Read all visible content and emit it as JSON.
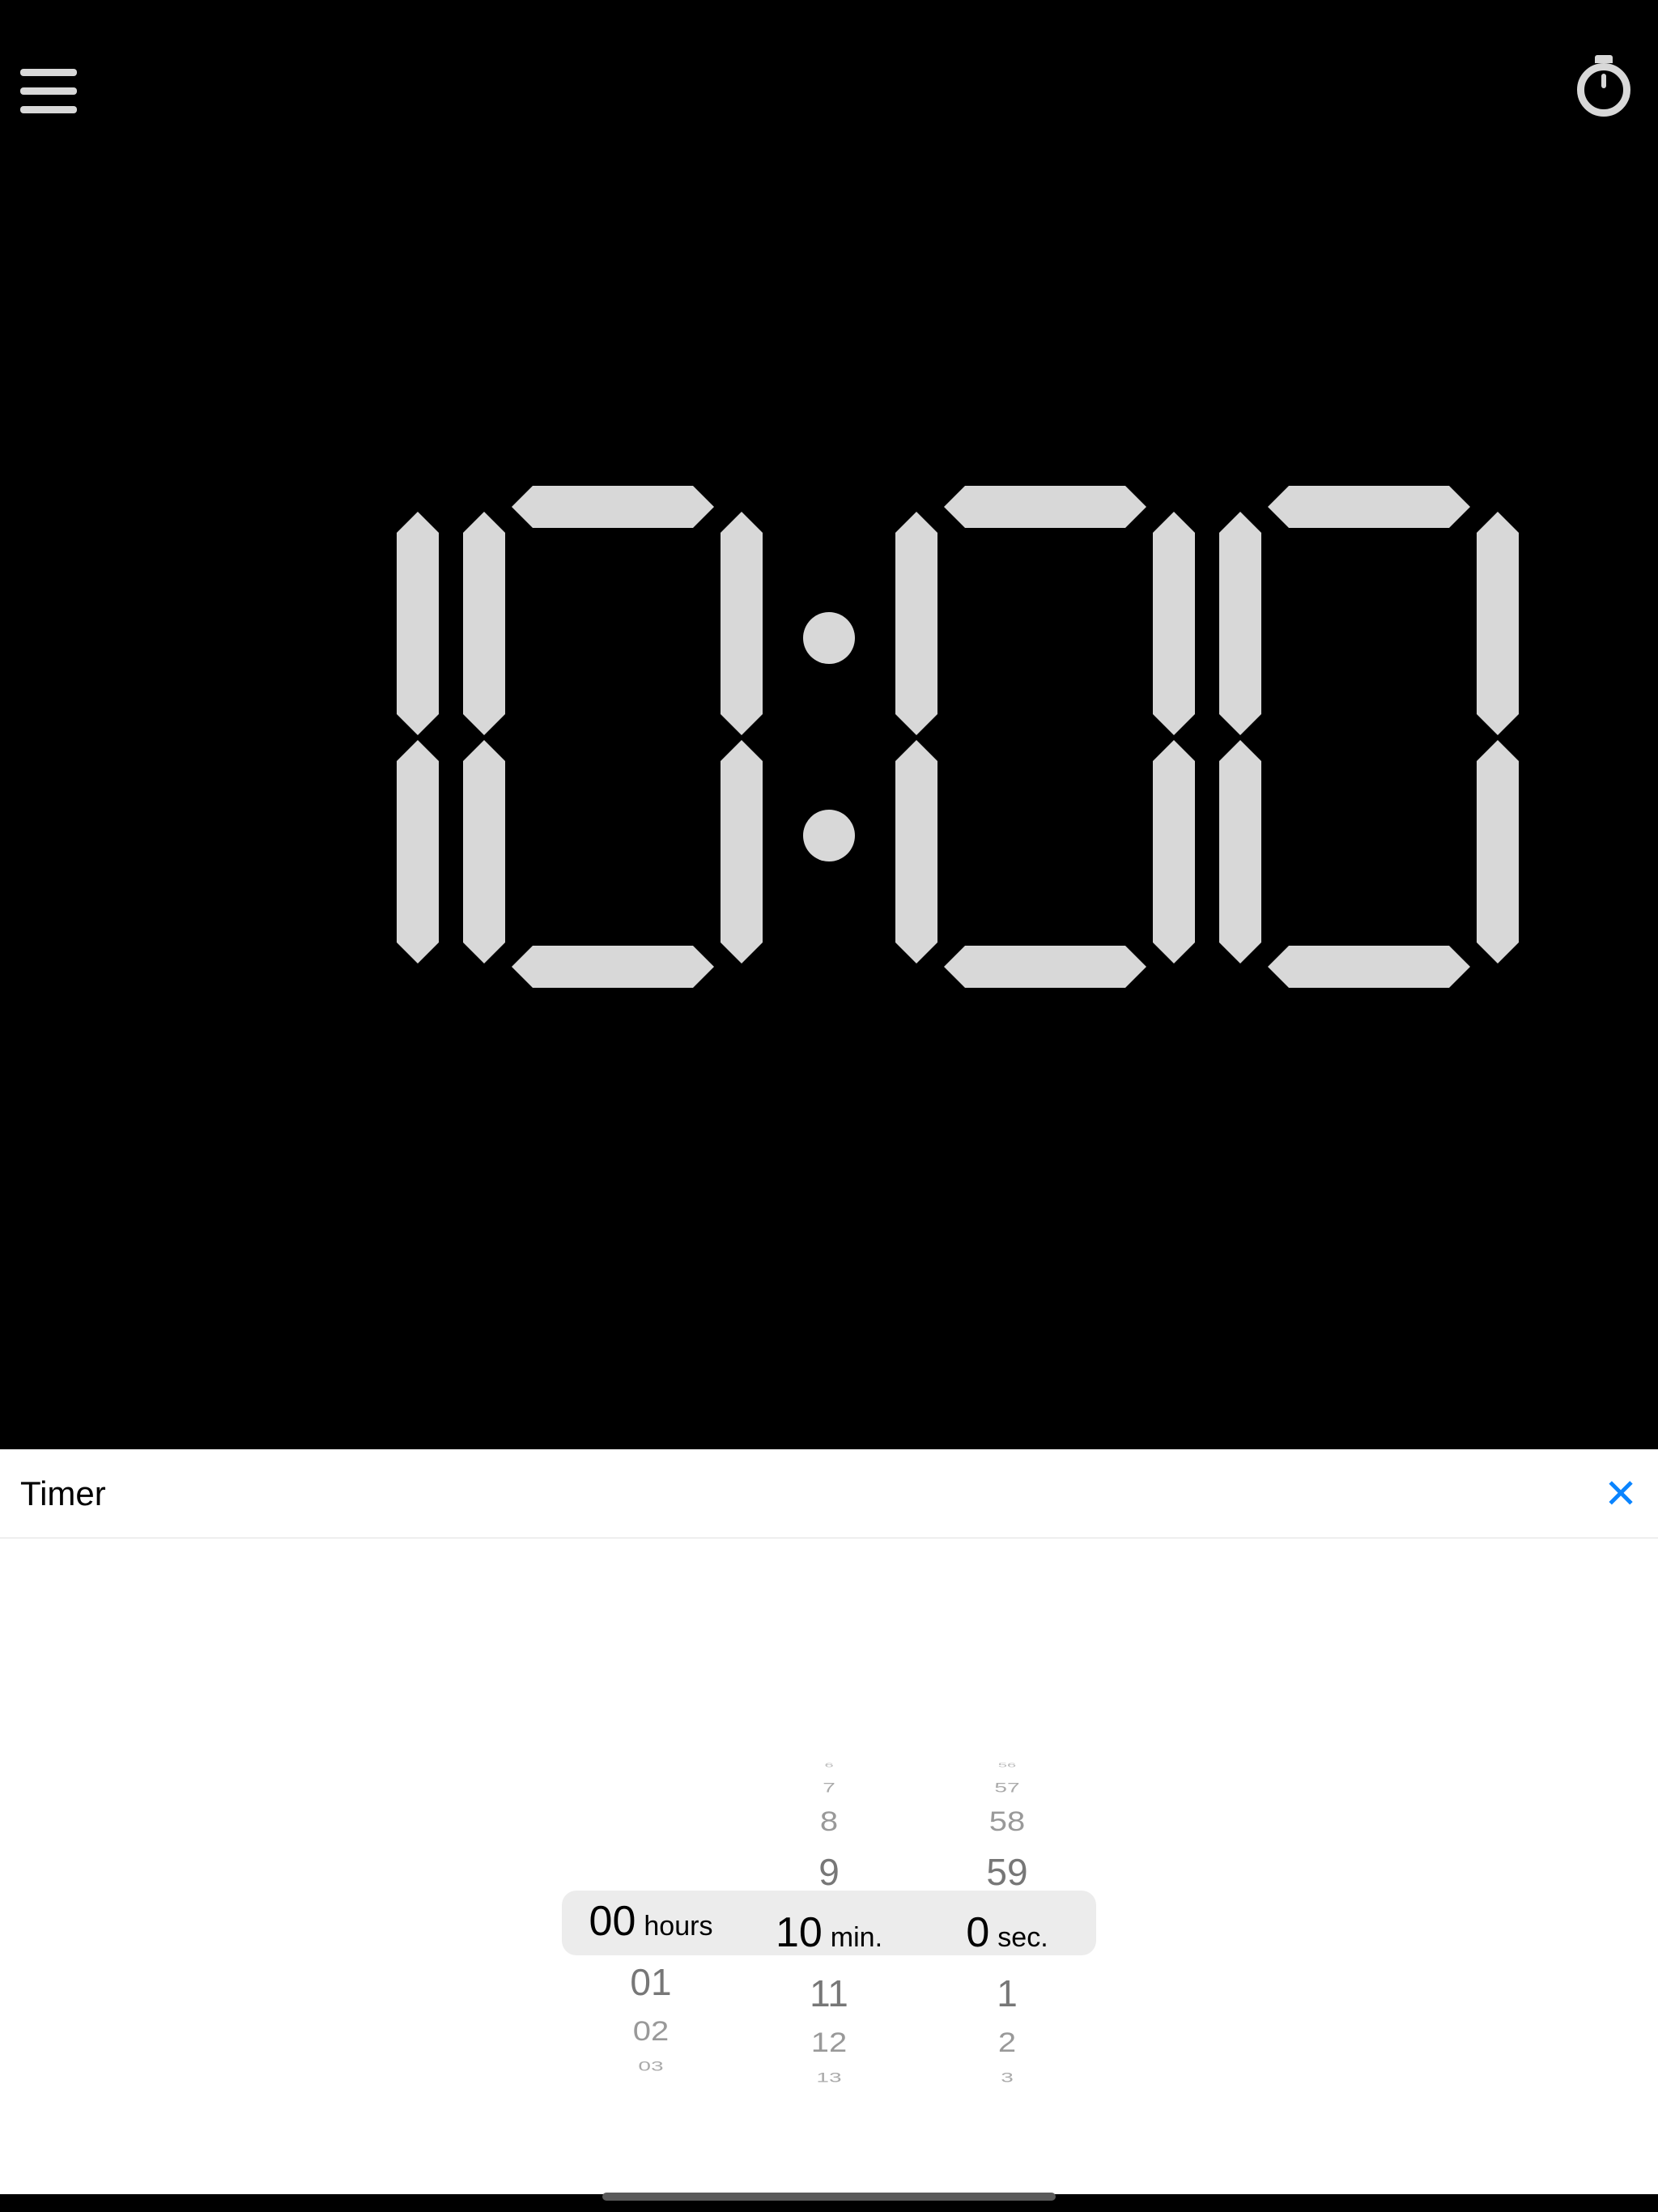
{
  "header": {
    "menu_label": "Menu",
    "mode_label": "Timer mode"
  },
  "display": {
    "mm": "10",
    "ss": "00"
  },
  "panel": {
    "title": "Timer",
    "close_label": "Close"
  },
  "picker": {
    "hours": {
      "selected": "00",
      "label": "hours",
      "after": [
        "01",
        "02",
        "03"
      ]
    },
    "minutes": {
      "before": [
        "6",
        "7",
        "8",
        "9"
      ],
      "selected": "10",
      "label": "min.",
      "after": [
        "11",
        "12",
        "13"
      ]
    },
    "seconds": {
      "before": [
        "56",
        "57",
        "58",
        "59"
      ],
      "selected": "0",
      "label": "sec.",
      "after": [
        "1",
        "2",
        "3"
      ]
    }
  }
}
